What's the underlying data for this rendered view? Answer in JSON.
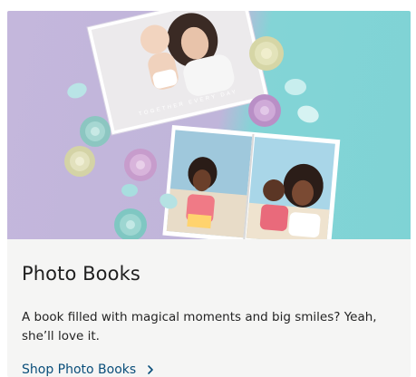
{
  "card": {
    "title": "Photo Books",
    "description": "A book filled with magical moments and big smiles? Yeah, she’ll love it.",
    "cta_label": "Shop Photo Books",
    "cover_text": "TOGETHER EVERY DAY"
  },
  "colors": {
    "lavender": "#c4b7dc",
    "aqua": "#7fd3d5",
    "link": "#0a4e7a",
    "card_bg": "#f5f5f4"
  },
  "icons": [
    "chevron-right-icon"
  ]
}
